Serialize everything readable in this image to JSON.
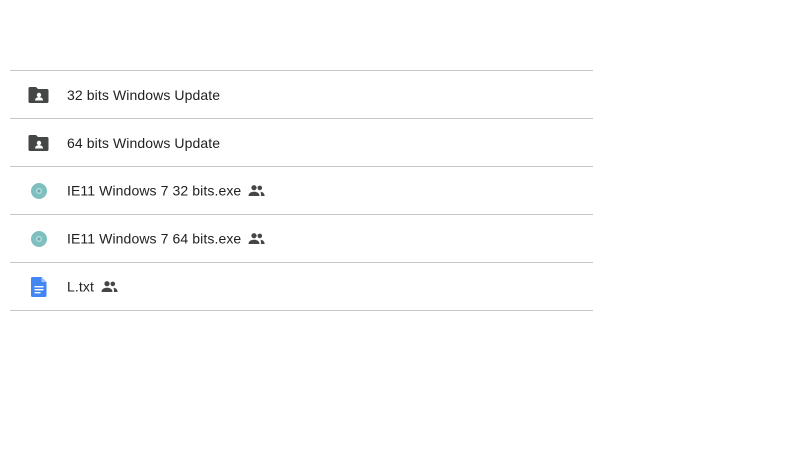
{
  "files": [
    {
      "name": "32 bits Windows Update",
      "icon": "shared-folder-icon",
      "shared": false
    },
    {
      "name": "64 bits Windows Update",
      "icon": "shared-folder-icon",
      "shared": false
    },
    {
      "name": "IE11 Windows 7 32 bits.exe",
      "icon": "disc-icon",
      "shared": true
    },
    {
      "name": "IE11 Windows 7 64 bits.exe",
      "icon": "disc-icon",
      "shared": true
    },
    {
      "name": "L.txt",
      "icon": "document-icon",
      "shared": true
    }
  ],
  "colors": {
    "folder": "#444746",
    "disc": "#7fbfbf",
    "document": "#4285f4",
    "shared_icon": "#444746",
    "divider": "#c6c6c6",
    "text": "#1f1f1f"
  }
}
